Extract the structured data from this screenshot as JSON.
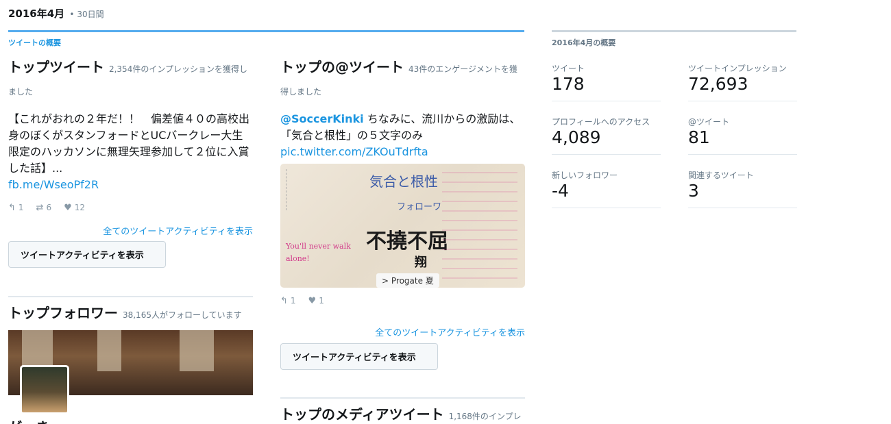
{
  "header": {
    "period": "2016年4月",
    "duration": "• 30日間"
  },
  "tweets_overview": {
    "label": "ツイートの概要",
    "top_tweet": {
      "title": "トップツイート",
      "meta": "2,354件のインプレッションを獲得しました",
      "text": "【これがおれの２年だ！！　偏差値４０の高校出身のぼくがスタンフォードとUCバークレー大生限定のハッカソンに無理矢理参加して２位に入賞した話】...",
      "link": "fb.me/WseoPf2R",
      "reply_count": "1",
      "retweet_count": "6",
      "like_count": "12",
      "view_all": "全てのツイートアクティビティを表示",
      "button": "ツイートアクティビティを表示"
    },
    "top_mention": {
      "title": "トップの@ツイート",
      "meta": "43件のエンゲージメントを獲得しました",
      "mention": "@SoccerKinki",
      "text": " ちなみに、流川からの激励は、「気合と根性」の５文字のみ",
      "link": "pic.twitter.com/ZKOuTdrfta",
      "reply_count": "1",
      "like_count": "1",
      "view_all": "全てのツイートアクティビティを表示",
      "button": "ツイートアクティビティを表示"
    },
    "top_follower": {
      "title": "トップフォロワー",
      "meta": "38,165人がフォローしています",
      "name_partial": "がっき"
    },
    "top_media": {
      "title": "トップのメディアツイート",
      "meta": "1,168件のインプレ"
    }
  },
  "photo": {
    "big_text": "不撓不屈",
    "sub_text": "翔",
    "hand1": "気合と根性",
    "hand2": "フォローワ",
    "hand3": "You'll never walk alone!",
    "sign": "> Progate 夏"
  },
  "summary": {
    "label": "2016年4月の概要",
    "stats": [
      {
        "label": "ツイート",
        "value": "178"
      },
      {
        "label": "ツイートインプレッション",
        "value": "72,693"
      },
      {
        "label": "プロフィールへのアクセス",
        "value": "4,089"
      },
      {
        "label": "@ツイート",
        "value": "81"
      },
      {
        "label": "新しいフォロワー",
        "value": "-4"
      },
      {
        "label": "関連するツイート",
        "value": "3"
      }
    ]
  },
  "colors": {
    "accent": "#1b95e0",
    "top_bar": "#55acee",
    "muted": "#657786"
  },
  "icons": [
    "reply-icon",
    "retweet-icon",
    "like-icon"
  ]
}
